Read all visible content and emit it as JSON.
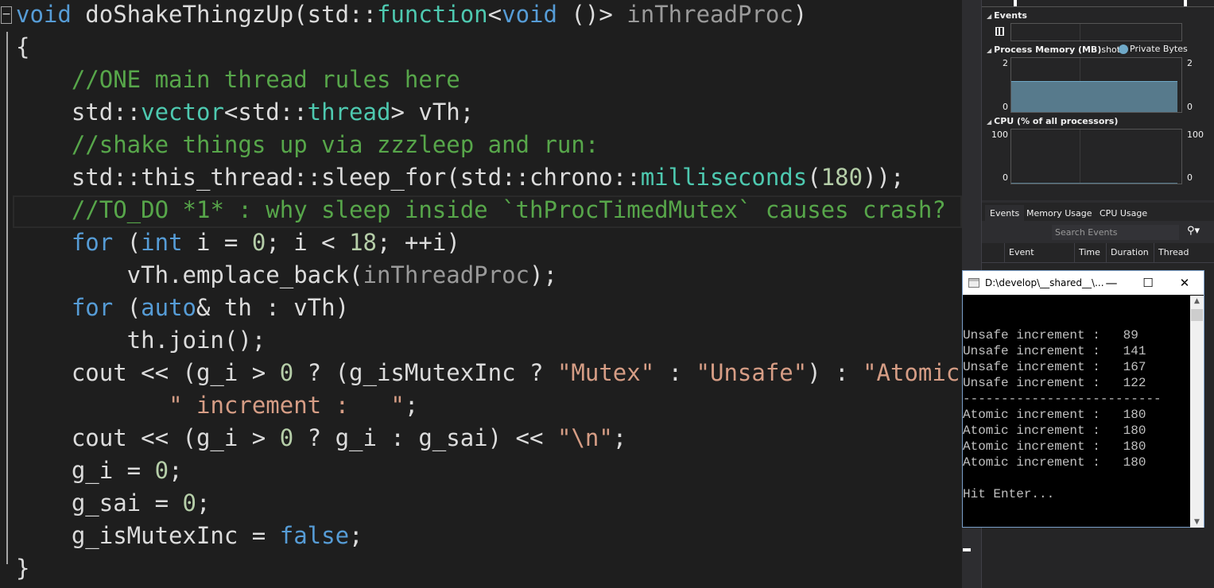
{
  "editor": {
    "fold_glyph": "−",
    "lines": [
      [
        [
          "void",
          "kw"
        ],
        [
          " doShakeThingzUp(",
          "fn"
        ],
        [
          "std::",
          "p"
        ],
        [
          "function",
          "type"
        ],
        [
          "<",
          "p"
        ],
        [
          "void",
          "kw"
        ],
        [
          " ()> ",
          "p"
        ],
        [
          "inThreadProc",
          "param"
        ],
        [
          ")",
          "p"
        ]
      ],
      [
        [
          "{",
          "p"
        ]
      ],
      [
        [
          "    ",
          "p"
        ],
        [
          "//ONE main thread rules here",
          "cm"
        ]
      ],
      [
        [
          "    std::",
          "p"
        ],
        [
          "vector",
          "type"
        ],
        [
          "<std::",
          "p"
        ],
        [
          "thread",
          "type"
        ],
        [
          "> vTh;",
          "p"
        ]
      ],
      [
        [
          "    ",
          "p"
        ],
        [
          "//shake things up via zzzleep and run:",
          "cm"
        ]
      ],
      [
        [
          "    std::this_thread::sleep_for(std::chrono::",
          "p"
        ],
        [
          "milliseconds",
          "type"
        ],
        [
          "(",
          "p"
        ],
        [
          "180",
          "num"
        ],
        [
          "));",
          "p"
        ]
      ],
      [
        [
          "    ",
          "p"
        ],
        [
          "//TO_DO *1* : why sleep inside `thProcTimedMutex` causes crash?",
          "cm"
        ]
      ],
      [
        [
          "    ",
          "p"
        ],
        [
          "for",
          "kw"
        ],
        [
          " (",
          "p"
        ],
        [
          "int",
          "kw"
        ],
        [
          " i = ",
          "p"
        ],
        [
          "0",
          "num"
        ],
        [
          "; i < ",
          "p"
        ],
        [
          "18",
          "num"
        ],
        [
          "; ++i)",
          "p"
        ]
      ],
      [
        [
          "        vTh.emplace_back(",
          "p"
        ],
        [
          "inThreadProc",
          "param"
        ],
        [
          ");",
          "p"
        ]
      ],
      [
        [
          "    ",
          "p"
        ],
        [
          "for",
          "kw"
        ],
        [
          " (",
          "p"
        ],
        [
          "auto",
          "kw"
        ],
        [
          "& th : vTh)",
          "p"
        ]
      ],
      [
        [
          "        th.join();",
          "p"
        ]
      ],
      [
        [
          "    cout << (g_i > ",
          "p"
        ],
        [
          "0",
          "num"
        ],
        [
          " ? (g_isMutexInc ? ",
          "p"
        ],
        [
          "\"Mutex\"",
          "str"
        ],
        [
          " : ",
          "p"
        ],
        [
          "\"Unsafe\"",
          "str"
        ],
        [
          ") : ",
          "p"
        ],
        [
          "\"Atomic\"",
          "str"
        ],
        [
          ") <<",
          "p"
        ]
      ],
      [
        [
          "           ",
          "p"
        ],
        [
          "\" increment :   \"",
          "str"
        ],
        [
          ";",
          "p"
        ]
      ],
      [
        [
          "    cout << (g_i > ",
          "p"
        ],
        [
          "0",
          "num"
        ],
        [
          " ? g_i : g_sai) << ",
          "p"
        ],
        [
          "\"\\n\"",
          "str"
        ],
        [
          ";",
          "p"
        ]
      ],
      [
        [
          "    g_i = ",
          "p"
        ],
        [
          "0",
          "num"
        ],
        [
          ";",
          "p"
        ]
      ],
      [
        [
          "    g_sai = ",
          "p"
        ],
        [
          "0",
          "num"
        ],
        [
          ";",
          "p"
        ]
      ],
      [
        [
          "    g_isMutexInc = ",
          "p"
        ],
        [
          "false",
          "kw"
        ],
        [
          ";",
          "p"
        ]
      ],
      [
        [
          "}",
          "p"
        ]
      ]
    ]
  },
  "diagnostics": {
    "events_header": "Events",
    "memory_header": "Process Memory (MB)",
    "memory_legend_snapshot": "shot",
    "memory_legend_private": "Private Bytes",
    "memory_axis": {
      "max": "2",
      "min": "0"
    },
    "memory_fill_fraction": 0.58,
    "cpu_header": "CPU (% of all processors)",
    "cpu_axis": {
      "max": "100",
      "min": "0"
    },
    "tabs": [
      "Events",
      "Memory Usage",
      "CPU Usage"
    ],
    "search_placeholder": "Search Events",
    "columns": [
      "Event",
      "Time",
      "Duration",
      "Thread"
    ],
    "colors": {
      "private_bytes": "#6fa9c8",
      "memory_fill": "#577a8c"
    }
  },
  "console": {
    "title": "D:\\develop\\__shared__\\...",
    "minimize": "—",
    "maximize": "☐",
    "close": "✕",
    "lines": [
      "Unsafe increment :   89",
      "Unsafe increment :   141",
      "Unsafe increment :   167",
      "Unsafe increment :   122",
      "--------------------------",
      "Atomic increment :   180",
      "Atomic increment :   180",
      "Atomic increment :   180",
      "Atomic increment :   180",
      "",
      "Hit Enter..."
    ]
  }
}
